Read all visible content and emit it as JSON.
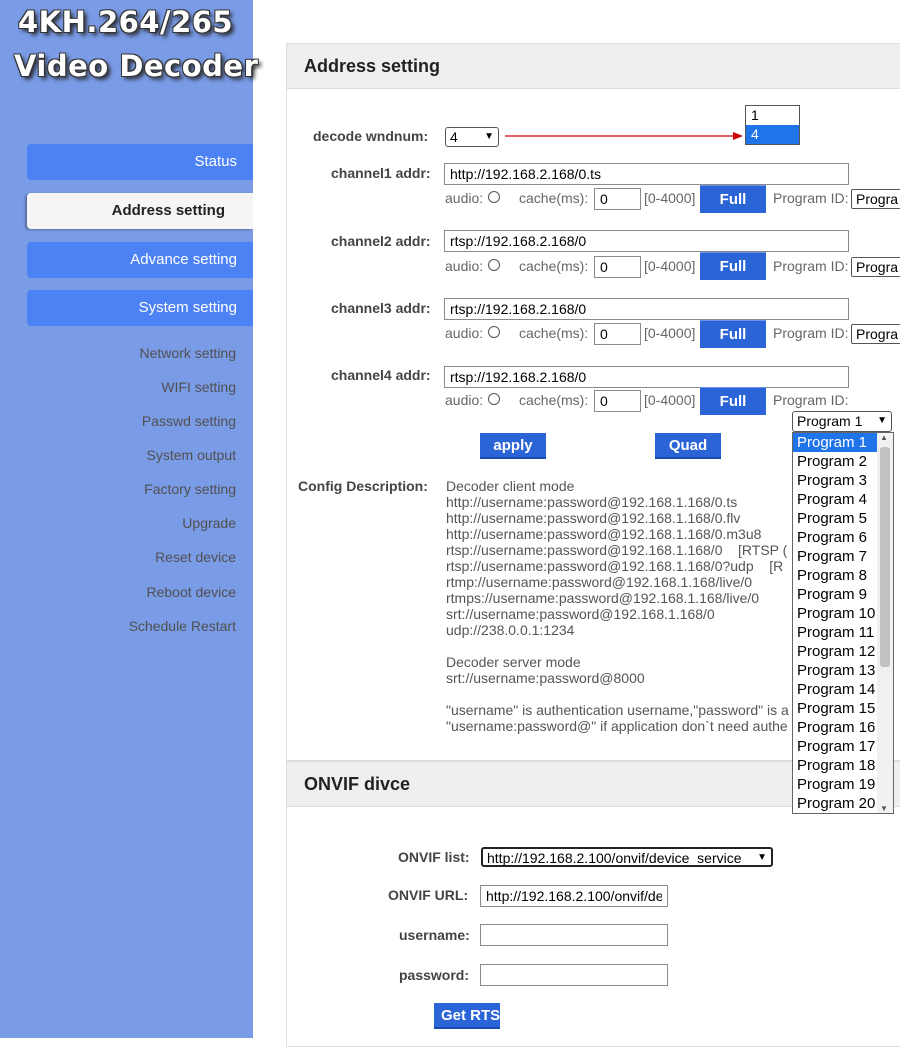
{
  "logo": {
    "line1": "4KH.264/265",
    "line2": "Video Decoder"
  },
  "sidebar": {
    "menu": [
      "Status",
      "Address setting",
      "Advance setting",
      "System setting"
    ],
    "subitems": [
      "Network setting",
      "WIFI setting",
      "Passwd setting",
      "System output",
      "Factory setting",
      "Upgrade",
      "Reset device",
      "Reboot device",
      "Schedule Restart"
    ]
  },
  "address": {
    "title": "Address setting",
    "wndnum_label": "decode wndnum:",
    "wndnum_value": "4",
    "wndnum_options": [
      "1",
      "4"
    ],
    "channels": [
      {
        "label": "channel1 addr:",
        "value": "http://192.168.2.168/0.ts"
      },
      {
        "label": "channel2 addr:",
        "value": "rtsp://192.168.2.168/0"
      },
      {
        "label": "channel3 addr:",
        "value": "rtsp://192.168.2.168/0"
      },
      {
        "label": "channel4 addr:",
        "value": "rtsp://192.168.2.168/0"
      }
    ],
    "audio_label": "audio:",
    "cache_label": "cache(ms):",
    "cache_value": "0",
    "cache_range": "[0-4000]",
    "full_label": "Full",
    "program_id_label": "Program ID:",
    "program_value_clipped": "Progra",
    "program_select": "Program 1",
    "apply_label": "apply",
    "quad_label": "Quad",
    "config_label": "Config Description:",
    "description": [
      "Decoder client mode",
      "http://username:password@192.168.1.168/0.ts",
      "http://username:password@192.168.1.168/0.flv",
      "http://username:password@192.168.1.168/0.m3u8",
      "rtsp://username:password@192.168.1.168/0    [RTSP (",
      "rtsp://username:password@192.168.1.168/0?udp    [R",
      "rtmp://username:password@192.168.1.168/live/0",
      "rtmps://username:password@192.168.1.168/live/0",
      "srt://username:password@192.168.1.168/0",
      "udp://238.0.0.1:1234",
      "",
      "Decoder server mode",
      "srt://username:password@8000",
      "",
      "\"username\" is authentication username,\"password\" is a",
      "\"username:password@\" if application don`t need authe"
    ],
    "program_options": [
      "Program 1",
      "Program 2",
      "Program 3",
      "Program 4",
      "Program 5",
      "Program 6",
      "Program 7",
      "Program 8",
      "Program 9",
      "Program 10",
      "Program 11",
      "Program 12",
      "Program 13",
      "Program 14",
      "Program 15",
      "Program 16",
      "Program 17",
      "Program 18",
      "Program 19",
      "Program 20"
    ]
  },
  "onvif": {
    "title": "ONVIF divce",
    "list_label": "ONVIF list:",
    "list_value": "http://192.168.2.100/onvif/device_service",
    "url_label": "ONVIF URL:",
    "url_value": "http://192.168.2.100/onvif/de",
    "username_label": "username:",
    "password_label": "password:",
    "get_label": "Get RTS"
  },
  "colors": {
    "sidebar": "#7a9be6",
    "menu_button": "#4d82f5",
    "action_button": "#2b64d6",
    "arrow": "#cc0000",
    "selection": "#1e74e8"
  }
}
